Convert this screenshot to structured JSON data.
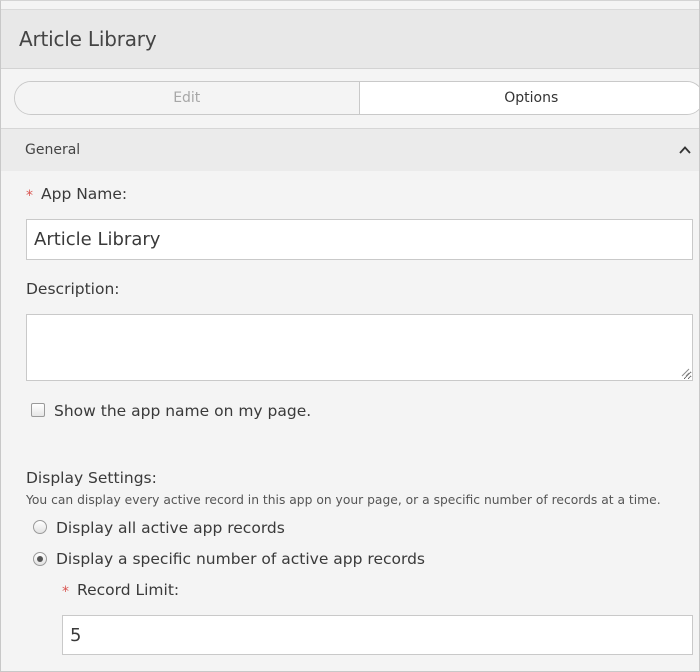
{
  "header": {
    "title": "Article Library"
  },
  "tabs": [
    {
      "label": "Edit",
      "active": false
    },
    {
      "label": "Options",
      "active": true
    }
  ],
  "section": {
    "title": "General",
    "expanded_icon": "chevron-up-icon"
  },
  "form": {
    "app_name": {
      "required_marker": "*",
      "label": "App Name:",
      "value": "Article Library"
    },
    "description": {
      "label": "Description:",
      "value": ""
    },
    "show_name": {
      "label": "Show the app name on my page.",
      "checked": false
    },
    "display_settings": {
      "label": "Display Settings:",
      "helper": "You can display every active record in this app on your page, or a specific number of records at a time.",
      "options": [
        {
          "label": "Display all active app records",
          "selected": false
        },
        {
          "label": "Display a specific number of active app records",
          "selected": true
        }
      ]
    },
    "record_limit": {
      "required_marker": "*",
      "label": "Record Limit:",
      "value": "5"
    }
  },
  "colors": {
    "required": "#d9534f",
    "header_bg": "#e8e8e8",
    "section_bg": "#ebebeb",
    "page_bg": "#f4f4f4"
  }
}
